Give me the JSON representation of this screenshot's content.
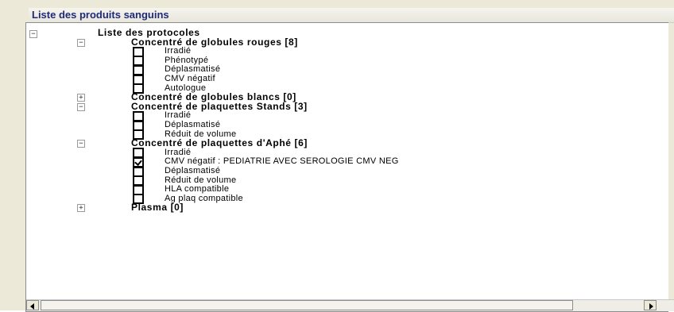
{
  "window": {
    "title": "Liste des produits sanguins"
  },
  "tree": {
    "root_label": "Liste des protocoles",
    "groups": [
      {
        "label": "Concentré de globules rouges [8]",
        "expanded": true,
        "items": [
          {
            "label": "Irradié",
            "checked": false
          },
          {
            "label": "Phénotypé",
            "checked": false
          },
          {
            "label": "Déplasmatisé",
            "checked": false
          },
          {
            "label": "CMV négatif",
            "checked": false
          },
          {
            "label": "Autologue",
            "checked": false
          }
        ]
      },
      {
        "label": "Concentré de globules blancs [0]",
        "expanded": false,
        "items": []
      },
      {
        "label": "Concentré de plaquettes Stands [3]",
        "expanded": true,
        "items": [
          {
            "label": "Irradié",
            "checked": false
          },
          {
            "label": "Déplasmatisé",
            "checked": false
          },
          {
            "label": "Réduit de volume",
            "checked": false
          }
        ]
      },
      {
        "label": "Concentré de plaquettes d'Aphé [6]",
        "expanded": true,
        "items": [
          {
            "label": "Irradié",
            "checked": false
          },
          {
            "label": "CMV négatif : PEDIATRIE AVEC SEROLOGIE CMV NEG",
            "checked": true
          },
          {
            "label": "Déplasmatisé",
            "checked": false
          },
          {
            "label": "Réduit de volume",
            "checked": false
          },
          {
            "label": "HLA compatible",
            "checked": false
          },
          {
            "label": "Ag plaq compatible",
            "checked": false
          }
        ]
      },
      {
        "label": "Plasma  [0]",
        "expanded": false,
        "items": []
      }
    ],
    "expander_glyphs": {
      "expanded": "−",
      "collapsed": "+"
    }
  },
  "scrollbar": {
    "left_arrow": "left-arrow-icon",
    "right_arrow": "right-arrow-icon"
  }
}
